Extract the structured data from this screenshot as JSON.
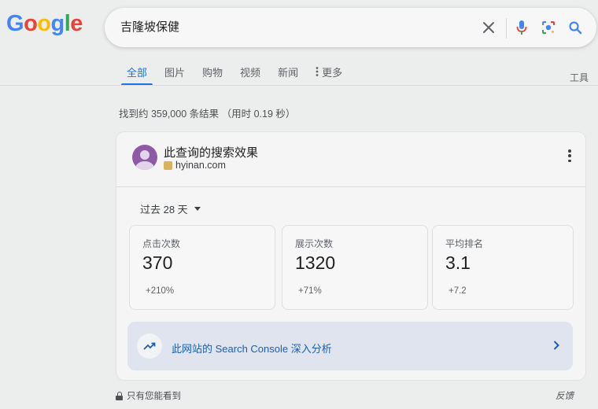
{
  "logo": {
    "letters": [
      "G",
      "o",
      "o",
      "g",
      "l",
      "e"
    ]
  },
  "search": {
    "query": "吉隆坡保健"
  },
  "tabs": [
    {
      "label": "全部",
      "active": true
    },
    {
      "label": "图片"
    },
    {
      "label": "购物"
    },
    {
      "label": "视频"
    },
    {
      "label": "新闻"
    },
    {
      "label": "更多"
    }
  ],
  "tools_label": "工具",
  "result_stats": "找到约 359,000 条结果 （用时 0.19 秒）",
  "card": {
    "title": "此查询的搜索效果",
    "site": "hyinan.com",
    "period": "过去 28 天",
    "metrics": [
      {
        "label": "点击次数",
        "value": "370",
        "delta": "+210%"
      },
      {
        "label": "展示次数",
        "value": "1320",
        "delta": "+71%"
      },
      {
        "label": "平均排名",
        "value": "3.1",
        "delta": "+7.2"
      }
    ],
    "console_link": "此网站的 Search Console 深入分析"
  },
  "footer": {
    "privacy": "只有您能看到",
    "feedback": "反馈"
  },
  "colors": {
    "accent": "#1a73e8",
    "background": "#eceded",
    "avatar": "#8e5aa6"
  }
}
